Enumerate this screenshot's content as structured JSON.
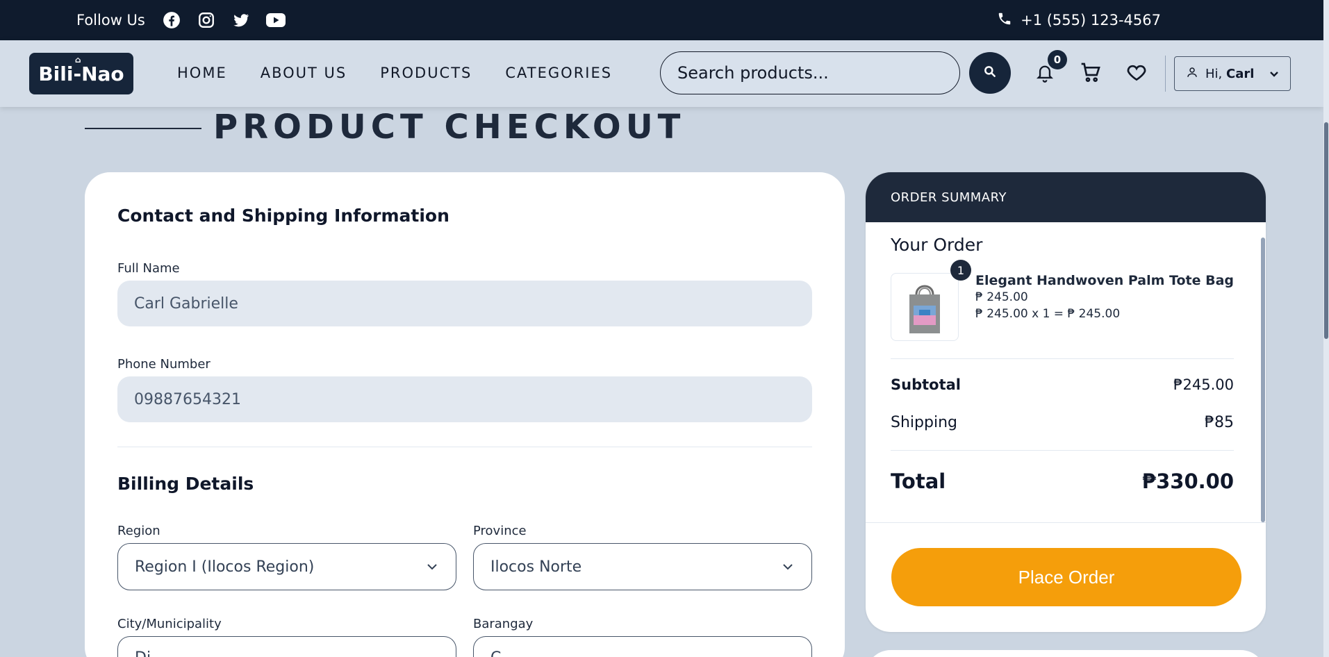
{
  "topbar": {
    "follow_label": "Follow Us",
    "social_icons": [
      "facebook-icon",
      "instagram-icon",
      "twitter-icon",
      "youtube-icon"
    ],
    "phone": "+1 (555) 123-4567"
  },
  "nav": {
    "logo": "Bili-Nao",
    "links": [
      "HOME",
      "ABOUT US",
      "PRODUCTS",
      "CATEGORIES"
    ],
    "search_placeholder": "Search products...",
    "notification_count": "0",
    "greeting": "Hi,",
    "user_name": "Carl"
  },
  "page": {
    "title": "PRODUCT CHECKOUT"
  },
  "form": {
    "contact_heading": "Contact and Shipping Information",
    "full_name_label": "Full Name",
    "full_name_value": "Carl Gabrielle",
    "phone_label": "Phone Number",
    "phone_value": "09887654321",
    "billing_heading": "Billing Details",
    "region_label": "Region",
    "region_value": "Region I (Ilocos Region)",
    "province_label": "Province",
    "province_value": "Ilocos Norte",
    "city_label": "City/Municipality",
    "city_value": "Di...",
    "barangay_label": "Barangay",
    "barangay_value": "C..."
  },
  "summary": {
    "header": "ORDER SUMMARY",
    "your_order": "Your Order",
    "item": {
      "qty_badge": "1",
      "name": "Elegant Handwoven Palm Tote Bag",
      "price": "₱ 245.00",
      "line": "₱ 245.00 x 1 = ₱ 245.00"
    },
    "subtotal_label": "Subtotal",
    "subtotal_value": "₱245.00",
    "shipping_label": "Shipping",
    "shipping_value": "₱85",
    "total_label": "Total",
    "total_value": "₱330.00",
    "place_order": "Place Order"
  },
  "colors": {
    "navy": "#0f1b2d",
    "accent_orange": "#f59e0b",
    "background": "#cbd5e1"
  }
}
